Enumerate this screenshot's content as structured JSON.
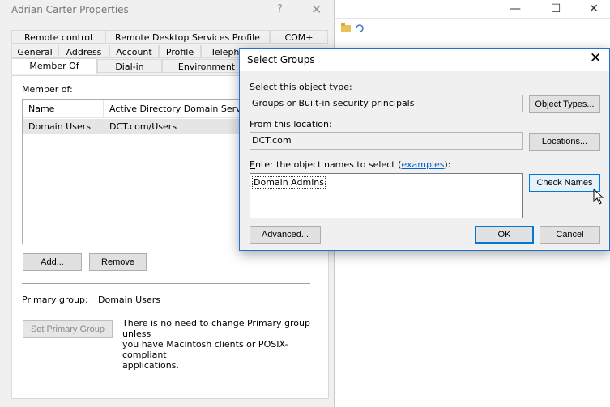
{
  "properties_window": {
    "title": "Adrian Carter Properties",
    "help": "?",
    "close": "✕",
    "tabs_row1": [
      "Remote control",
      "Remote Desktop Services Profile",
      "COM+"
    ],
    "tabs_row2": [
      "General",
      "Address",
      "Account",
      "Profile",
      "Telephones"
    ],
    "tabs_row3": [
      "Member Of",
      "Dial-in",
      "Environment"
    ],
    "active_tab": "Member Of",
    "member_of_label": "Member of:",
    "list": {
      "columns": [
        "Name",
        "Active Directory Domain Services Folder"
      ],
      "rows": [
        [
          "Domain Users",
          "DCT.com/Users"
        ]
      ]
    },
    "add_button": "Add...",
    "remove_button": "Remove",
    "primary_group_label": "Primary group:",
    "primary_group_value": "Domain Users",
    "set_primary_button": "Set Primary Group",
    "primary_info": [
      "There is no need to change Primary group unless",
      "you have Macintosh clients or POSIX-compliant",
      "applications."
    ]
  },
  "background_window": {
    "minimize": "—",
    "maximize": "☐",
    "close": "✕"
  },
  "select_groups_dialog": {
    "title": "Select Groups",
    "close": "✕",
    "object_type_label": "Select this object type:",
    "object_type_value": "Groups or Built-in security principals",
    "object_types_button": "Object Types...",
    "location_label": "From this location:",
    "location_value": "DCT.com",
    "locations_button": "Locations...",
    "enter_names_prefix": "nter the object names to select (",
    "enter_names_accel": "E",
    "examples_link": "examples",
    "enter_names_suffix": "):",
    "names_value": "Domain Admins",
    "check_names_button": "Check Names",
    "advanced_button": "Advanced...",
    "ok_button": "OK",
    "cancel_button": "Cancel"
  }
}
